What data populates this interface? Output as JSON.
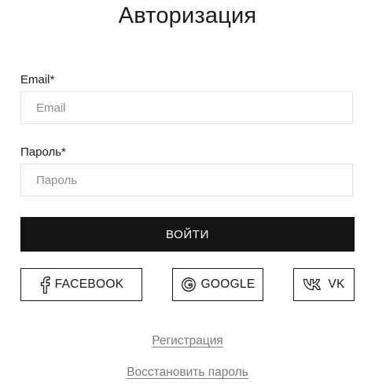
{
  "page": {
    "title": "Авторизация"
  },
  "form": {
    "email": {
      "label": "Email",
      "required_mark": "*",
      "placeholder": "Email",
      "value": ""
    },
    "password": {
      "label": "Пароль",
      "required_mark": "*",
      "placeholder": "Пароль",
      "value": ""
    },
    "submit_label": "ВОЙТИ"
  },
  "social": {
    "facebook": {
      "label": "FACEBOOK",
      "icon": "facebook-icon"
    },
    "google": {
      "label": "GOOGLE",
      "icon": "google-icon"
    },
    "vk": {
      "label": "VK",
      "icon": "vk-icon"
    }
  },
  "links": {
    "register": "Регистрация",
    "restore_password": "Восстановить пароль"
  },
  "colors": {
    "primary_button_bg": "#141414",
    "primary_button_text": "#ffffff",
    "input_border": "#e4e4e4",
    "link_text": "#7a7a7a"
  }
}
